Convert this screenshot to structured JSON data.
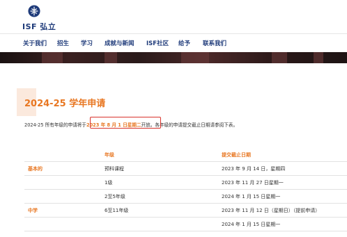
{
  "header": {
    "logo_text": "ISF 弘立",
    "logo_icon": "isf-crest-icon"
  },
  "nav": {
    "items": [
      {
        "label": "关于我们"
      },
      {
        "label": "招生"
      },
      {
        "label": "学习"
      },
      {
        "label": "成就与新闻"
      },
      {
        "label": "ISF社区"
      },
      {
        "label": "给予"
      },
      {
        "label": "联系我们"
      }
    ]
  },
  "page": {
    "title": "2024-25 学年申请",
    "intro_before": "2024-25 所有年级的申请将于",
    "intro_highlight": "2023 年 8 月 1 日星期二",
    "intro_after": "开放。各年级的申请提交截止日期请参阅下表。"
  },
  "table": {
    "headers": {
      "grade": "年级",
      "deadline": "提交截止日期"
    },
    "sections": [
      {
        "category": "基本的",
        "rows": [
          {
            "grade": "预科课程",
            "deadline": "2023 年 9 月 14 日，星期四"
          },
          {
            "grade": "1级",
            "deadline": "2023 年 11 月 27 日星期一"
          },
          {
            "grade": "2至5年级",
            "deadline": "2024 年 1 月 15 日星期一"
          }
        ]
      },
      {
        "category": "中学",
        "rows": [
          {
            "grade": "6至11年级",
            "deadline": "2023 年 11 月 12 日（星期日）（提前申请）"
          },
          {
            "grade": "",
            "deadline": "2024 年 1 月 15 日星期一"
          }
        ]
      }
    ]
  },
  "colors": {
    "brand_blue": "#1f3b7a",
    "accent_orange": "#e87722",
    "highlight_red": "#d8312a"
  }
}
